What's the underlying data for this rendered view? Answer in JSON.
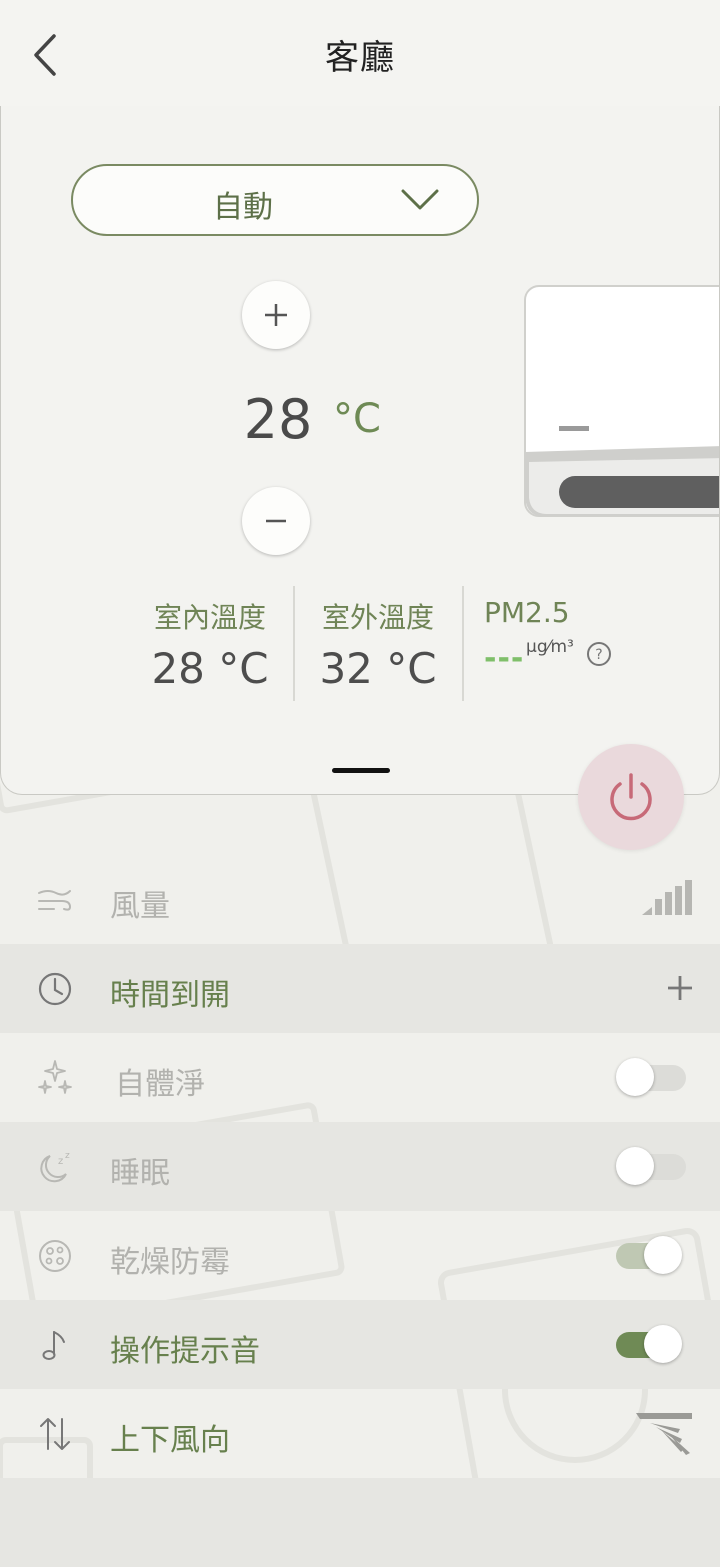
{
  "header": {
    "title": "客廳"
  },
  "control": {
    "mode": "自動",
    "set_temperature": "28",
    "temperature_unit": "°C"
  },
  "readings": {
    "indoor": {
      "label": "室內溫度",
      "value": "28 °C"
    },
    "outdoor": {
      "label": "室外溫度",
      "value": "32 °C"
    },
    "pm25": {
      "label": "PM2.5",
      "value": "---",
      "unit": "µg⁄m³"
    }
  },
  "settings": [
    {
      "label": "風量",
      "icon": "wind-icon",
      "state": "disabled",
      "control": "fan-level-icon"
    },
    {
      "label": "時間到開",
      "icon": "clock-icon",
      "state": "enabled",
      "control": "add"
    },
    {
      "label": "自體淨",
      "icon": "sparkle-icon",
      "state": "disabled",
      "control": "toggle",
      "value": "off"
    },
    {
      "label": "睡眠",
      "icon": "sleep-icon",
      "state": "disabled",
      "control": "toggle",
      "value": "off"
    },
    {
      "label": "乾燥防霉",
      "icon": "mold-icon",
      "state": "disabled",
      "control": "toggle",
      "value": "on"
    },
    {
      "label": "操作提示音",
      "icon": "music-note-icon",
      "state": "enabled",
      "control": "toggle",
      "value": "on"
    },
    {
      "label": "上下風向",
      "icon": "up-down-arrows-icon",
      "state": "enabled",
      "control": "swing-icon"
    }
  ],
  "colors": {
    "accent_green": "#6f8a55",
    "power_pink": "#ead9dc",
    "power_icon": "#c76a78",
    "pm_green": "#7fbf6a"
  }
}
